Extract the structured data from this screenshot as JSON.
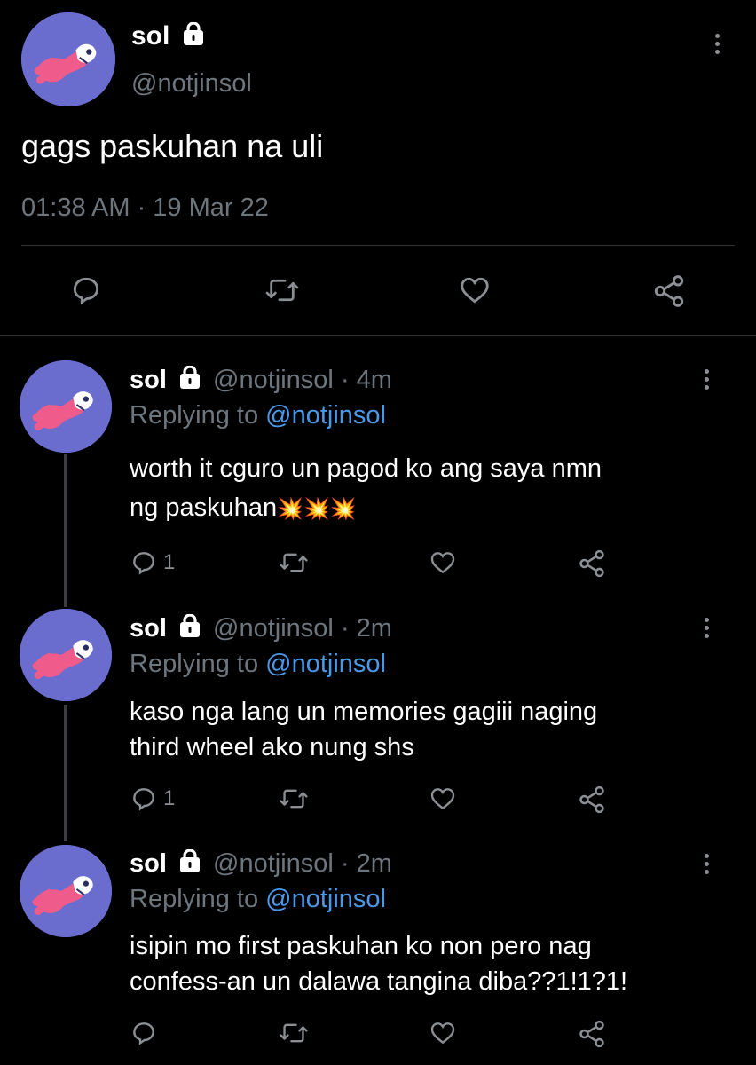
{
  "main_tweet": {
    "display_name": "sol",
    "handle": "@notjinsol",
    "text": "gags paskuhan na uli",
    "timestamp": "01:38 AM · 19 Mar 22"
  },
  "replies": [
    {
      "display_name": "sol",
      "handle": "@notjinsol",
      "time": "· 4m",
      "replying_label": "Replying to",
      "replying_to": "@notjinsol",
      "text_line1": "worth it cguro un pagod ko ang saya nmn",
      "text_line2": "ng paskuhan",
      "emoji": "💥💥💥",
      "reply_count": "1"
    },
    {
      "display_name": "sol",
      "handle": "@notjinsol",
      "time": "· 2m",
      "replying_label": "Replying to",
      "replying_to": "@notjinsol",
      "text_line1": "kaso nga lang un memories gagiii naging",
      "text_line2": "third wheel ako nung shs",
      "reply_count": "1"
    },
    {
      "display_name": "sol",
      "handle": "@notjinsol",
      "time": "· 2m",
      "replying_label": "Replying to",
      "replying_to": "@notjinsol",
      "text_line1": "isipin mo first paskuhan ko non pero nag",
      "text_line2": "confess-an un dalawa tangina diba??1!1?1!",
      "reply_count": ""
    }
  ],
  "icons": {
    "lock": "lock-icon",
    "reply": "speech-bubble-icon",
    "retweet": "retweet-icon",
    "like": "heart-icon",
    "share": "share-nodes-icon",
    "more": "vertical-ellipsis-icon"
  },
  "colors": {
    "background": "#000000",
    "text": "#e7e9ea",
    "muted": "#6e767d",
    "link": "#4a99e9",
    "avatar": "#6a6dcd"
  }
}
